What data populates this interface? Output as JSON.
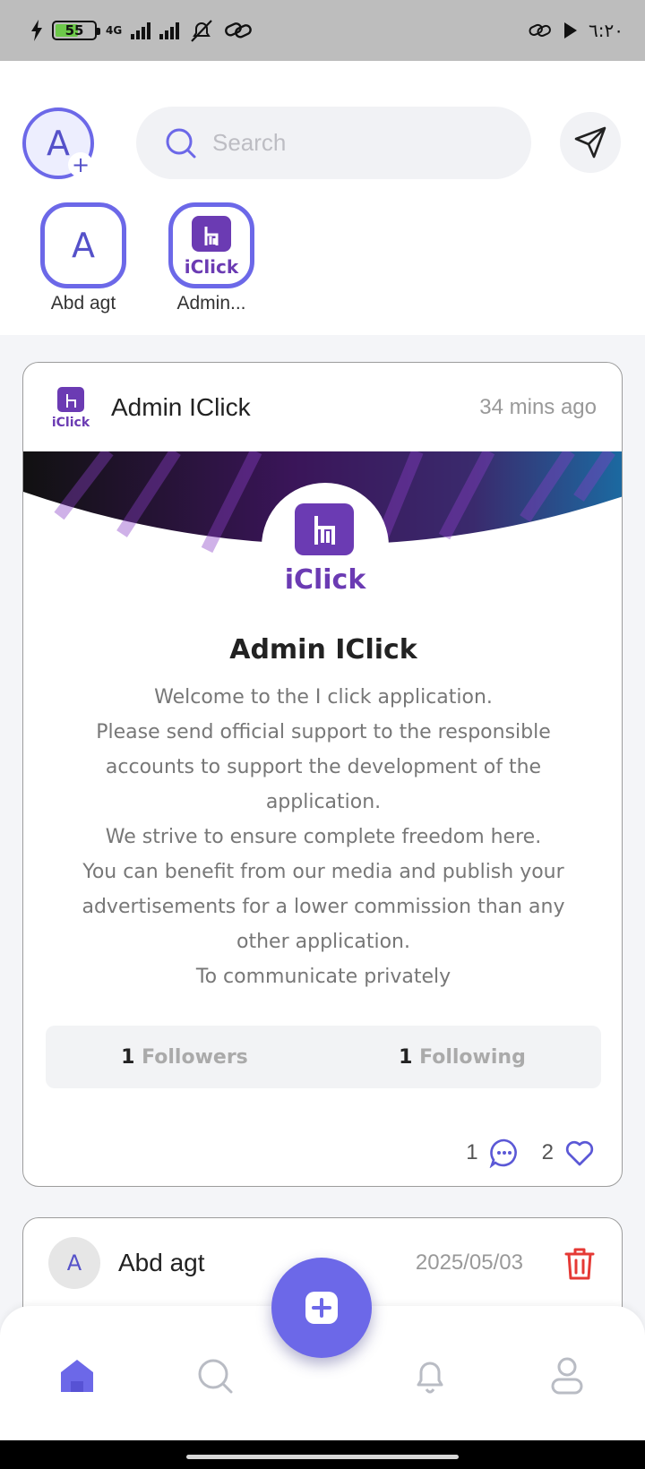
{
  "status_bar": {
    "battery": "55",
    "network": "4G",
    "time": "٦:٢٠"
  },
  "header": {
    "avatar_letter": "A",
    "add_symbol": "+",
    "search_placeholder": "Search",
    "send_icon": "send-icon"
  },
  "stories": [
    {
      "letter": "A",
      "name": "Abd agt"
    },
    {
      "logo_text": "iClick",
      "name": "Admin..."
    }
  ],
  "posts": [
    {
      "author": "Admin IClick",
      "time": "34 mins ago",
      "media": {
        "logo_text": "iClick",
        "title": "Admin IClick",
        "text": "Welcome to the I click application.\nPlease send official support to the responsible accounts to support the development of the application.\nWe strive to ensure complete freedom here.\nYou can benefit from our media and publish your advertisements for a lower commission than any other application.\nTo communicate privately",
        "followers_count": "1",
        "followers_label": "Followers",
        "following_count": "1",
        "following_label": "Following"
      },
      "comments": "1",
      "likes": "2"
    },
    {
      "avatar_letter": "A",
      "author": "Abd agt",
      "date": "2025/05/03"
    }
  ],
  "bottom_nav": {
    "items": [
      "home-icon",
      "search-icon",
      "bell-icon",
      "profile-icon"
    ],
    "active": "home-icon"
  },
  "colors": {
    "accent": "#6c68e8",
    "status_bar": "#bdbdbd",
    "danger": "#e53935"
  }
}
